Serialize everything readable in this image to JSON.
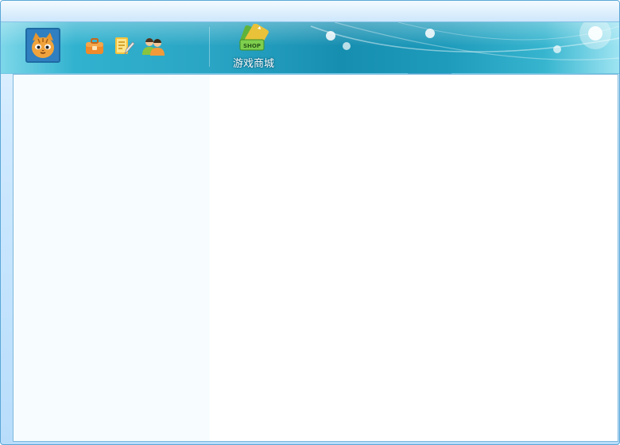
{
  "window": {
    "title": ""
  },
  "toolbar": {
    "avatar": {
      "icon": "cat-avatar-icon"
    },
    "buttons": [
      {
        "name": "box-button",
        "icon": "toolbox-icon"
      },
      {
        "name": "notes-button",
        "icon": "note-pencil-icon"
      },
      {
        "name": "friends-button",
        "icon": "users-icon"
      }
    ],
    "shop": {
      "label": "游戏商城",
      "badge": "SHOP",
      "icon": "shop-icon"
    }
  },
  "colors": {
    "banner_accent": "#2aa5c4",
    "left_panel_bg": "#f7fdfe",
    "border": "#7db8dc"
  }
}
